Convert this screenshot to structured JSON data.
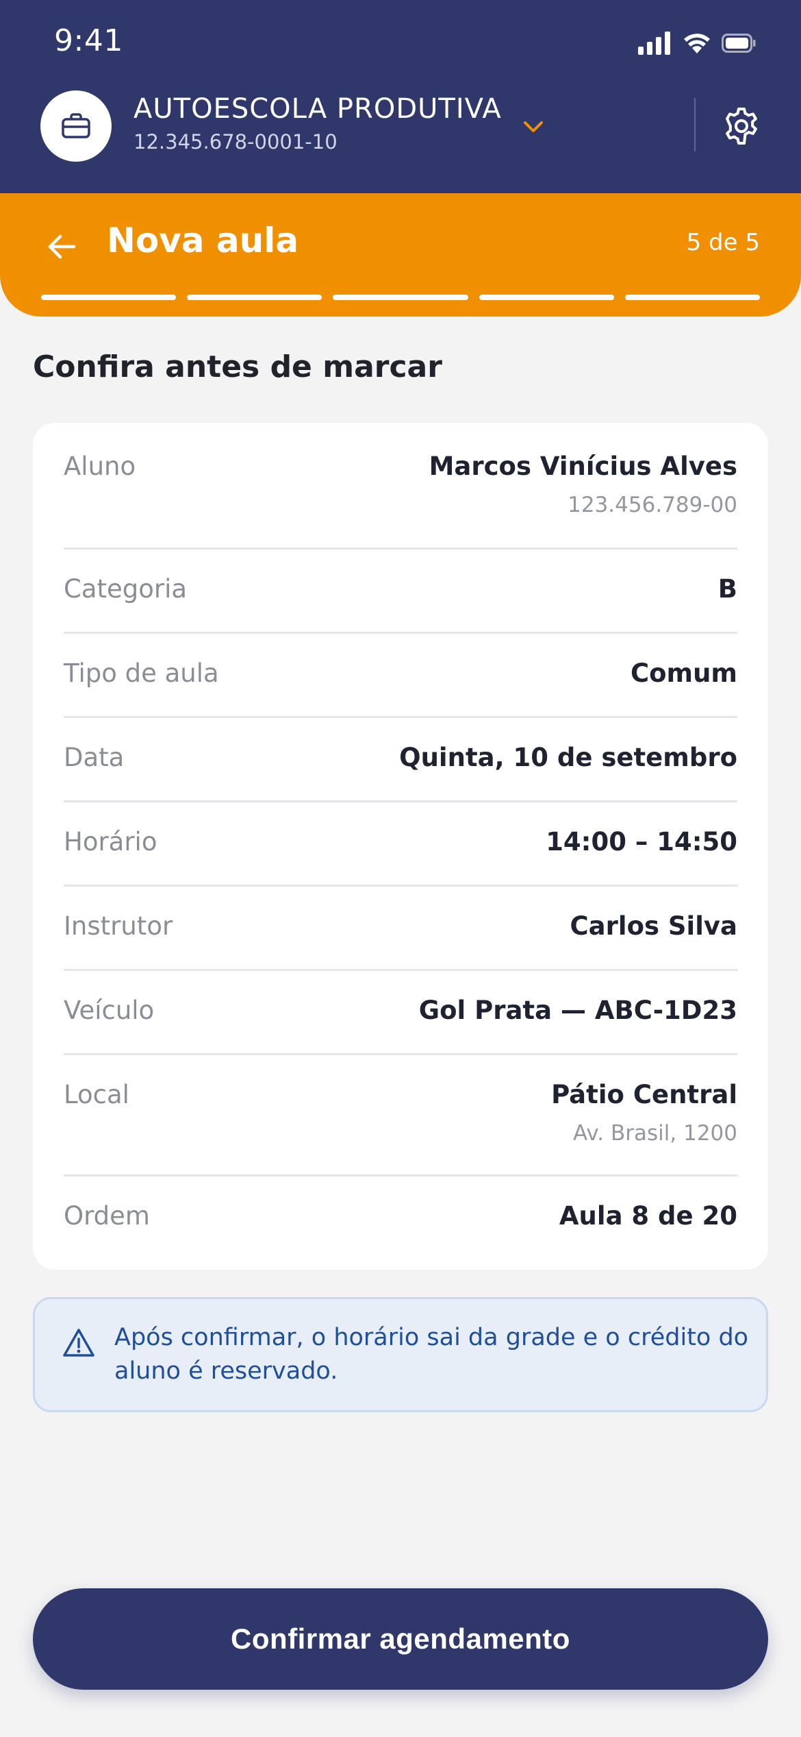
{
  "status_bar": {
    "time": "9:41"
  },
  "account": {
    "name": "AUTOESCOLA PRODUTIVA",
    "cnpj": "12.345.678-0001-10",
    "icon": "briefcase-icon"
  },
  "step": {
    "title": "Nova aula",
    "counter": "5 de 5",
    "total_steps": 5,
    "current_step": 5
  },
  "section_title": "Confira antes de marcar",
  "summary": [
    {
      "label": "Aluno",
      "value": "Marcos Vinícius Alves",
      "sub": "123.456.789-00"
    },
    {
      "label": "Categoria",
      "value": "B",
      "sub": ""
    },
    {
      "label": "Tipo de aula",
      "value": "Comum",
      "sub": ""
    },
    {
      "label": "Data",
      "value": "Quinta, 10 de setembro",
      "sub": ""
    },
    {
      "label": "Horário",
      "value": "14:00 – 14:50",
      "sub": ""
    },
    {
      "label": "Instrutor",
      "value": "Carlos Silva",
      "sub": ""
    },
    {
      "label": "Veículo",
      "value": "Gol Prata — ABC-1D23",
      "sub": ""
    },
    {
      "label": "Local",
      "value": "Pátio Central",
      "sub": "Av. Brasil, 1200"
    },
    {
      "label": "Ordem",
      "value": "Aula 8 de 20",
      "sub": ""
    }
  ],
  "notice": {
    "icon": "warning-icon",
    "text": "Após confirmar, o horário sai da grade e o crédito do aluno é reservado."
  },
  "cta": {
    "label": "Confirmar agendamento"
  },
  "colors": {
    "primary": "#2f376b",
    "accent": "#f08f00",
    "background": "#f3f3f4",
    "notice_bg": "#e8eef8",
    "notice_text": "#1f4e9a"
  }
}
